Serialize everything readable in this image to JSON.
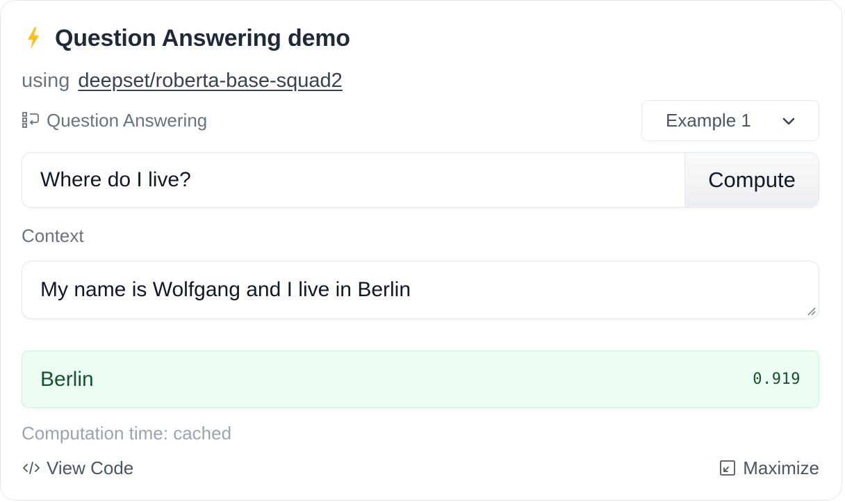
{
  "widget": {
    "title": "Question Answering demo",
    "using_label": "using",
    "model_name": "deepset/roberta-base-squad2",
    "task_label": "Question Answering",
    "example_select": {
      "selected": "Example 1"
    },
    "question": {
      "value": "Where do I live?",
      "compute_label": "Compute"
    },
    "context": {
      "label": "Context",
      "value": "My name is Wolfgang and I live in Berlin"
    },
    "answer": {
      "text": "Berlin",
      "score": "0.919"
    },
    "computation_time": "Computation time: cached",
    "footer": {
      "view_code_label": "View Code",
      "maximize_label": "Maximize"
    }
  },
  "colors": {
    "accent_bolt": "#fbbf24",
    "answer_bg": "#ecfdf3",
    "answer_text": "#14532d"
  }
}
